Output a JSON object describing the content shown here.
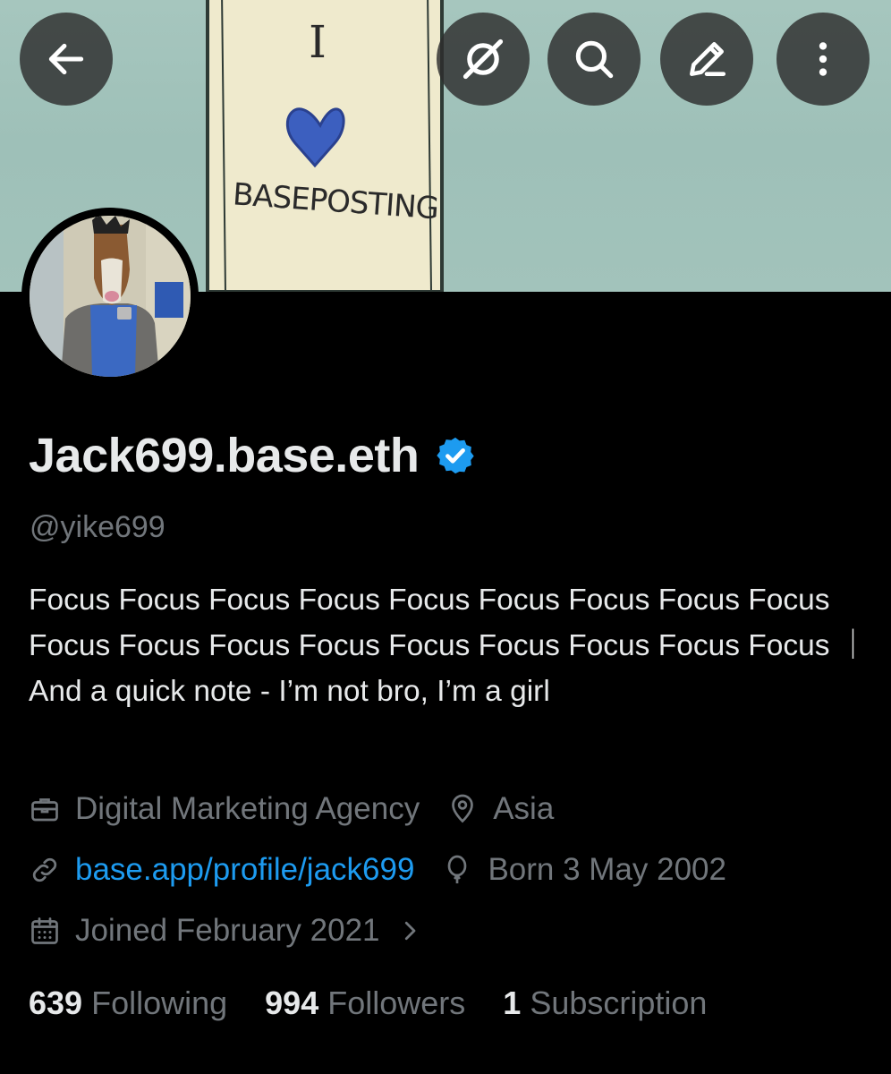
{
  "header": {
    "banner_text": "BASEPOSTING",
    "banner_letter": "I",
    "buttons": {
      "back": "arrow-left-icon",
      "grok": "grok-icon",
      "search": "search-icon",
      "edit": "edit-icon",
      "more": "more-vertical-icon"
    }
  },
  "profile": {
    "display_name": "Jack699.base.eth",
    "verified": true,
    "handle": "@yike699",
    "bio": "Focus Focus Focus Focus Focus Focus Focus Focus Focus Focus Focus Focus Focus Focus Focus Focus Focus Focus ｜ And a quick note - I’m not bro, I’m a girl",
    "category": "Digital Marketing Agency",
    "location": "Asia",
    "website": "base.app/profile/jack699",
    "birthday": "Born 3 May 2002",
    "joined": "Joined February 2021"
  },
  "stats": {
    "following_count": "639",
    "following_label": "Following",
    "followers_count": "994",
    "followers_label": "Followers",
    "subscription_count": "1",
    "subscription_label": "Subscription"
  },
  "colors": {
    "background": "#000000",
    "text": "#e7e9ea",
    "muted": "#71767b",
    "link": "#1d9bf0",
    "verified": "#1d9bf0"
  }
}
